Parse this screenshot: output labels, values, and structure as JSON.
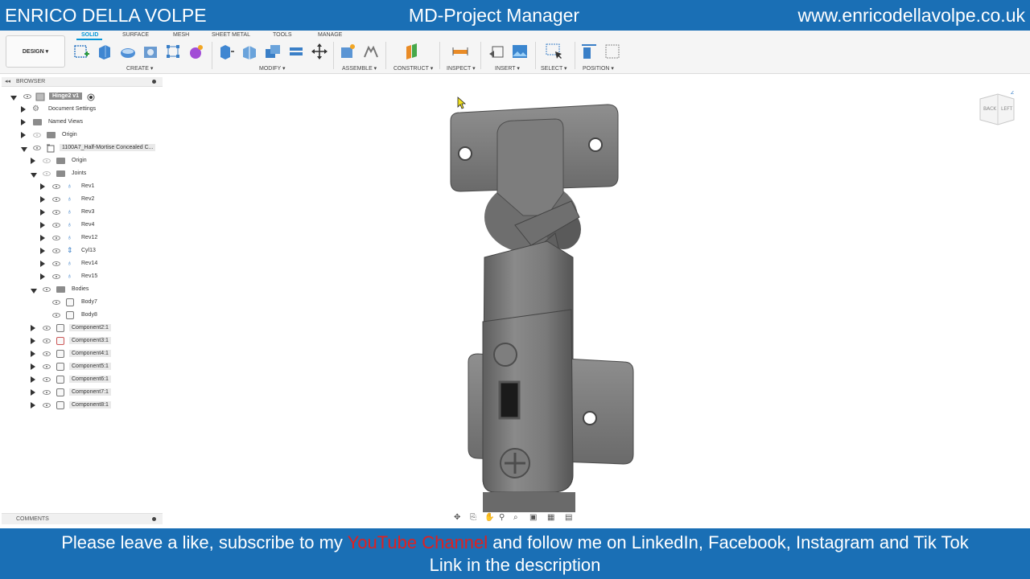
{
  "banner_top": {
    "left": "ENRICO DELLA VOLPE",
    "center": "MD-Project Manager",
    "right": "www.enricodellavolpe.co.uk"
  },
  "toolbar": {
    "design_label": "DESIGN ▾",
    "tabs": [
      "SOLID",
      "SURFACE",
      "MESH",
      "SHEET METAL",
      "TOOLS",
      "MANAGE"
    ],
    "groups": [
      "CREATE ▾",
      "MODIFY ▾",
      "ASSEMBLE ▾",
      "CONSTRUCT ▾",
      "INSPECT ▾",
      "INSERT ▾",
      "SELECT ▾",
      "POSITION ▾"
    ]
  },
  "browser": {
    "title": "BROWSER",
    "items": [
      {
        "label": "Hinge2 v1"
      },
      {
        "label": "Document Settings"
      },
      {
        "label": "Named Views"
      },
      {
        "label": "Origin"
      },
      {
        "label": "1100A7_Half-Mortise Concealed C..."
      },
      {
        "label": "Origin"
      },
      {
        "label": "Joints"
      },
      {
        "label": "Rev1"
      },
      {
        "label": "Rev2"
      },
      {
        "label": "Rev3"
      },
      {
        "label": "Rev4"
      },
      {
        "label": "Rev12"
      },
      {
        "label": "Cyl13"
      },
      {
        "label": "Rev14"
      },
      {
        "label": "Rev15"
      },
      {
        "label": "Bodies"
      },
      {
        "label": "Body7"
      },
      {
        "label": "Body8"
      },
      {
        "label": "Component2:1"
      },
      {
        "label": "Component3:1"
      },
      {
        "label": "Component4:1"
      },
      {
        "label": "Component5:1"
      },
      {
        "label": "Component6:1"
      },
      {
        "label": "Component7:1"
      },
      {
        "label": "Component8:1"
      }
    ]
  },
  "comments": {
    "title": "COMMENTS"
  },
  "viewcube": {
    "back": "BACK",
    "left": "LEFT",
    "z": "Z"
  },
  "banner_bottom": {
    "line1_a": "Please leave a like, subscribe to my ",
    "line1_red": "YouTube Channel",
    "line1_b": " and follow me on LinkedIn, Facebook, Instagram and Tik Tok",
    "line2": "Link in the description"
  }
}
